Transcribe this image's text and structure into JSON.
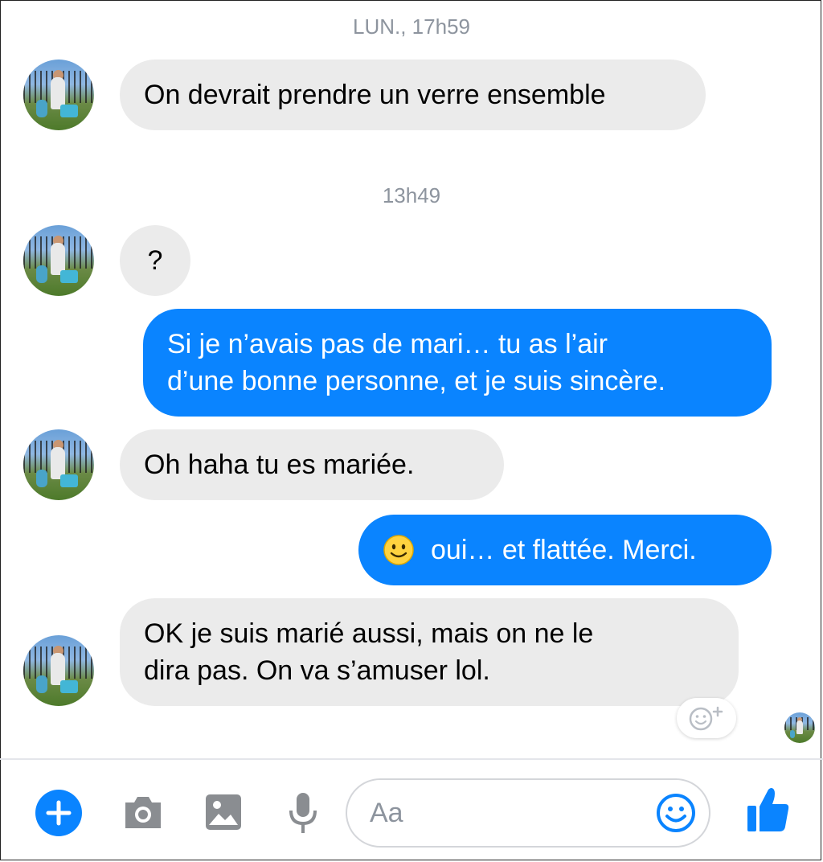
{
  "colors": {
    "accent": "#0a84ff",
    "incoming_bubble": "#ebebeb",
    "timestamp": "#8d949e",
    "icon_gray": "#8a8d91"
  },
  "thread": {
    "timestamp_1": "LUN., 17h59",
    "timestamp_2": "13h49",
    "messages": [
      {
        "from": "them",
        "text": "On devrait prendre un verre ensemble"
      },
      {
        "from": "them",
        "text": "?"
      },
      {
        "from": "me",
        "lines": [
          "Si je n’avais pas de mari… tu as l’air",
          "d’une bonne personne, et je suis sincère."
        ]
      },
      {
        "from": "them",
        "text": "Oh haha tu es mariée."
      },
      {
        "from": "me",
        "emoji": "smiling-face-emoji",
        "text": "oui… et flattée. Merci."
      },
      {
        "from": "them",
        "lines": [
          "OK je suis marié aussi, mais on ne le",
          "dira pas. On va s’amuser lol."
        ]
      }
    ]
  },
  "composer": {
    "placeholder": "Aa",
    "icons": [
      "plus-icon",
      "camera-icon",
      "image-icon",
      "microphone-icon",
      "emoji-icon",
      "thumbs-up-icon"
    ]
  }
}
